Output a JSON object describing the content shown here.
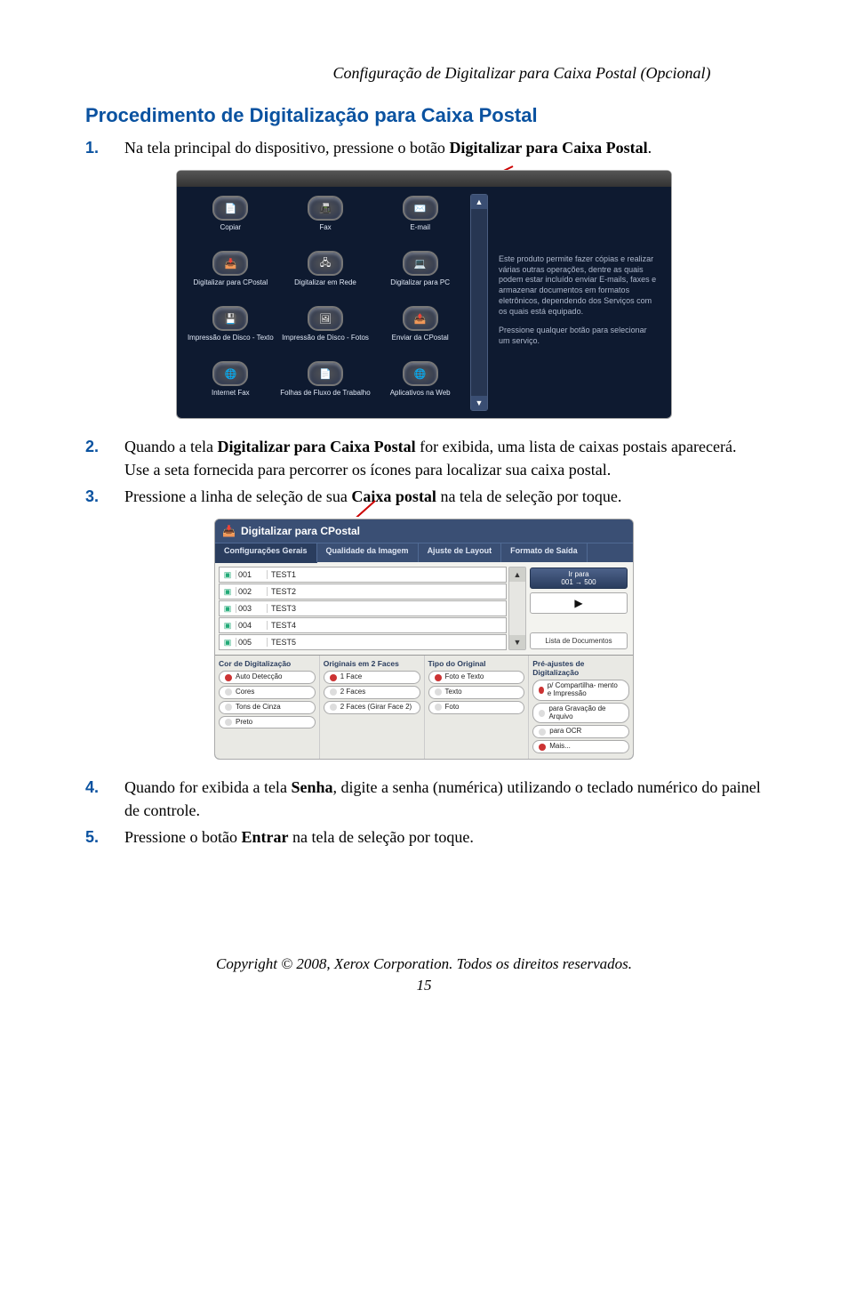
{
  "header": {
    "running_title": "Configuração de Digitalizar para Caixa Postal (Opcional)"
  },
  "section": {
    "title": "Procedimento de Digitalização para Caixa Postal"
  },
  "steps": {
    "s1_pre": "Na tela principal do dispositivo, pressione o botão ",
    "s1_bold": "Digitalizar para Caixa Postal",
    "s1_post": ".",
    "s2_pre": "Quando a tela ",
    "s2_bold": "Digitalizar para Caixa Postal",
    "s2_mid": " for exibida, uma lista de caixas postais aparecerá. Use a seta fornecida para percorrer os ícones para localizar sua caixa postal.",
    "s3_pre": "Pressione a linha de seleção de sua ",
    "s3_bold": "Caixa postal",
    "s3_post": " na tela de seleção por toque.",
    "s4_pre": "Quando for exibida a tela ",
    "s4_bold": "Senha",
    "s4_post": ", digite a senha (numérica) utilizando o teclado numérico do painel de controle.",
    "s5_pre": "Pressione o botão ",
    "s5_bold": "Entrar",
    "s5_post": " na tela de seleção por toque."
  },
  "device1": {
    "tiles": [
      {
        "icon": "📄",
        "label": "Copiar"
      },
      {
        "icon": "📠",
        "label": "Fax"
      },
      {
        "icon": "✉️",
        "label": "E-mail"
      },
      {
        "icon": "📥",
        "label": "Digitalizar para CPostal"
      },
      {
        "icon": "🖧",
        "label": "Digitalizar em Rede"
      },
      {
        "icon": "💻",
        "label": "Digitalizar para PC"
      },
      {
        "icon": "💾",
        "label": "Impressão de Disco - Texto"
      },
      {
        "icon": "🖼",
        "label": "Impressão de Disco - Fotos"
      },
      {
        "icon": "📤",
        "label": "Enviar da CPostal"
      },
      {
        "icon": "🌐",
        "label": "Internet Fax"
      },
      {
        "icon": "📄",
        "label": "Folhas de Fluxo de Trabalho"
      },
      {
        "icon": "🌐",
        "label": "Aplicativos na Web"
      }
    ],
    "info_text": "Este produto permite fazer cópias e realizar várias outras operações, dentre as quais podem estar incluído enviar E-mails, faxes e armazenar documentos em formatos eletrônicos, dependendo dos Serviços com os quais está equipado.",
    "info_text2": "Pressione qualquer botão para selecionar um serviço."
  },
  "device2": {
    "title": "Digitalizar para CPostal",
    "tabs": [
      "Configurações Gerais",
      "Qualidade da Imagem",
      "Ajuste de Layout",
      "Formato de Saída"
    ],
    "mailboxes": [
      {
        "num": "001",
        "name": "TEST1"
      },
      {
        "num": "002",
        "name": "TEST2"
      },
      {
        "num": "003",
        "name": "TEST3"
      },
      {
        "num": "004",
        "name": "TEST4"
      },
      {
        "num": "005",
        "name": "TEST5"
      }
    ],
    "goto_label_line1": "Ir para",
    "goto_label_line2": "001 → 500",
    "play": "▶",
    "docs_btn": "Lista de Documentos",
    "opts": {
      "col1_head": "Cor de Digitalização",
      "col1": [
        "Auto Detecção",
        "Cores",
        "Tons de Cinza",
        "Preto"
      ],
      "col2_head": "Originais em 2 Faces",
      "col2": [
        "1 Face",
        "2 Faces",
        "2 Faces (Girar Face 2)"
      ],
      "col3_head": "Tipo do Original",
      "col3": [
        "Foto e Texto",
        "Texto",
        "Foto"
      ],
      "col4_head": "Pré-ajustes de Digitalização",
      "col4": [
        "p/ Compartilha- mento e Impressão",
        "para Gravação de Arquivo",
        "para OCR",
        "Mais..."
      ]
    }
  },
  "footer": {
    "copyright": "Copyright © 2008, Xerox Corporation. Todos os direitos reservados.",
    "page_number": "15"
  }
}
